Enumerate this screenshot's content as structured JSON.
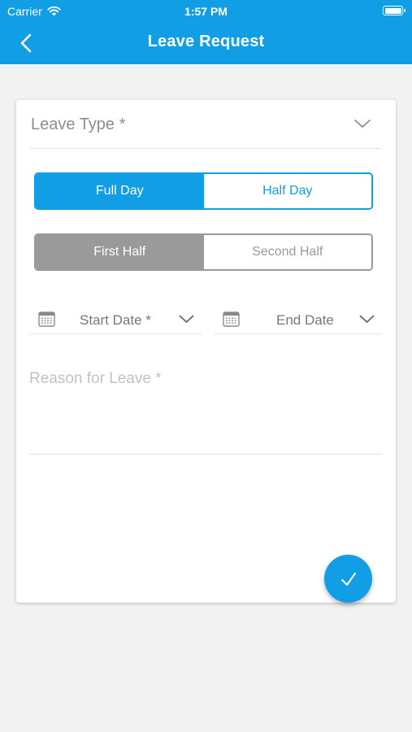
{
  "status_bar": {
    "carrier": "Carrier",
    "time": "1:57 PM"
  },
  "nav": {
    "title": "Leave Request",
    "back_icon": "chevron-left-icon",
    "background_color": "#129ee4"
  },
  "form": {
    "leave_type": {
      "label": "Leave Type *",
      "icon": "chevron-down-icon"
    },
    "day_toggle": {
      "options": [
        "Full Day",
        "Half Day"
      ],
      "selected": "Full Day",
      "accent_color": "#129ee4"
    },
    "half_toggle": {
      "options": [
        "First Half",
        "Second Half"
      ],
      "selected": "First Half",
      "accent_color": "#9a9a9a"
    },
    "start_date": {
      "label": "Start Date *",
      "icon": "calendar-icon"
    },
    "end_date": {
      "label": "End Date",
      "icon": "calendar-icon"
    },
    "reason": {
      "placeholder": "Reason for Leave *"
    },
    "submit_icon": "checkmark-icon"
  }
}
